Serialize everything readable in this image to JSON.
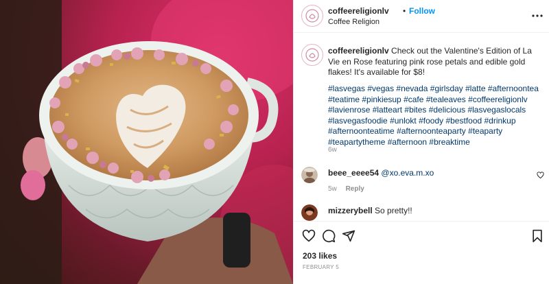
{
  "post": {
    "username": "coffeereligionlv",
    "follow_label": "Follow",
    "separator": "•",
    "location": "Coffee Religion",
    "caption": "Check out the Valentine's Edition of La Vie en Rose featuring pink rose petals and edible gold flakes! It's available for $8!",
    "hashtags": "#lasvegas #vegas #nevada #girlsday #latte #afternoontea #teatime #pinkiesup #cafe #tealeaves #coffeereligionlv #lavienrose #latteart #bites #delicious #lasvegaslocals #lasvegasfoodie #unlokt #foody #bestfood #drinkup #afternoonteatime #afternoonteaparty #teaparty #teapartytheme #afternoon #breaktime",
    "age": "6w",
    "likes": "203 likes",
    "date": "FEBRUARY 5"
  },
  "comments": [
    {
      "user": "beee_eeee54",
      "text": "@xo.eva.m.xo",
      "age": "5w",
      "reply_label": "Reply"
    },
    {
      "user": "mizzerybell",
      "text": "So pretty!!"
    }
  ],
  "icons": {
    "more": "more-options-icon",
    "like": "heart-icon",
    "comment": "comment-icon",
    "share": "share-icon",
    "save": "bookmark-icon"
  },
  "colors": {
    "follow": "#0095f6",
    "hashtag": "#00376b",
    "meta": "#8e8e8e"
  }
}
